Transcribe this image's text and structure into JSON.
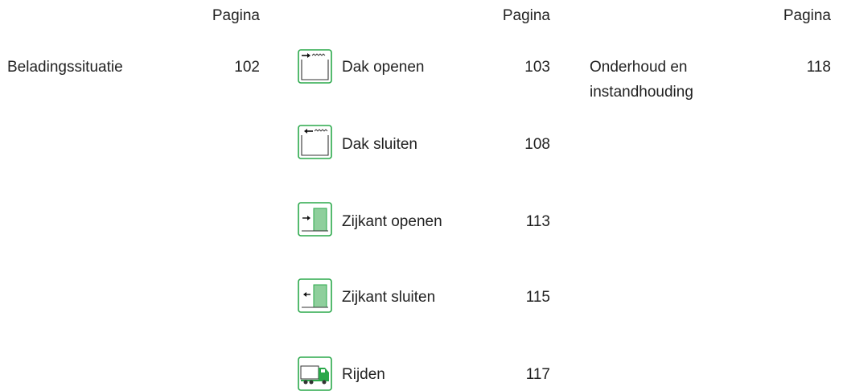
{
  "columns": [
    {
      "header": "Pagina",
      "items": [
        {
          "label": "Beladingssituatie",
          "page": "102"
        }
      ]
    },
    {
      "header": "Pagina",
      "items": [
        {
          "label": "Dak openen",
          "page": "103",
          "icon": "roof-open-icon"
        },
        {
          "label": "Dak sluiten",
          "page": "108",
          "icon": "roof-close-icon"
        },
        {
          "label": "Zijkant openen",
          "page": "113",
          "icon": "side-open-icon"
        },
        {
          "label": "Zijkant sluiten",
          "page": "115",
          "icon": "side-close-icon"
        },
        {
          "label": "Rijden",
          "page": "117",
          "icon": "truck-driving-icon"
        }
      ]
    },
    {
      "header": "Pagina",
      "items": [
        {
          "label_line1": "Onderhoud en",
          "label_line2": "instandhouding",
          "page": "118"
        }
      ]
    }
  ],
  "colors": {
    "accent": "#2aa84a",
    "fill": "#8fcf9c",
    "text": "#222222"
  }
}
